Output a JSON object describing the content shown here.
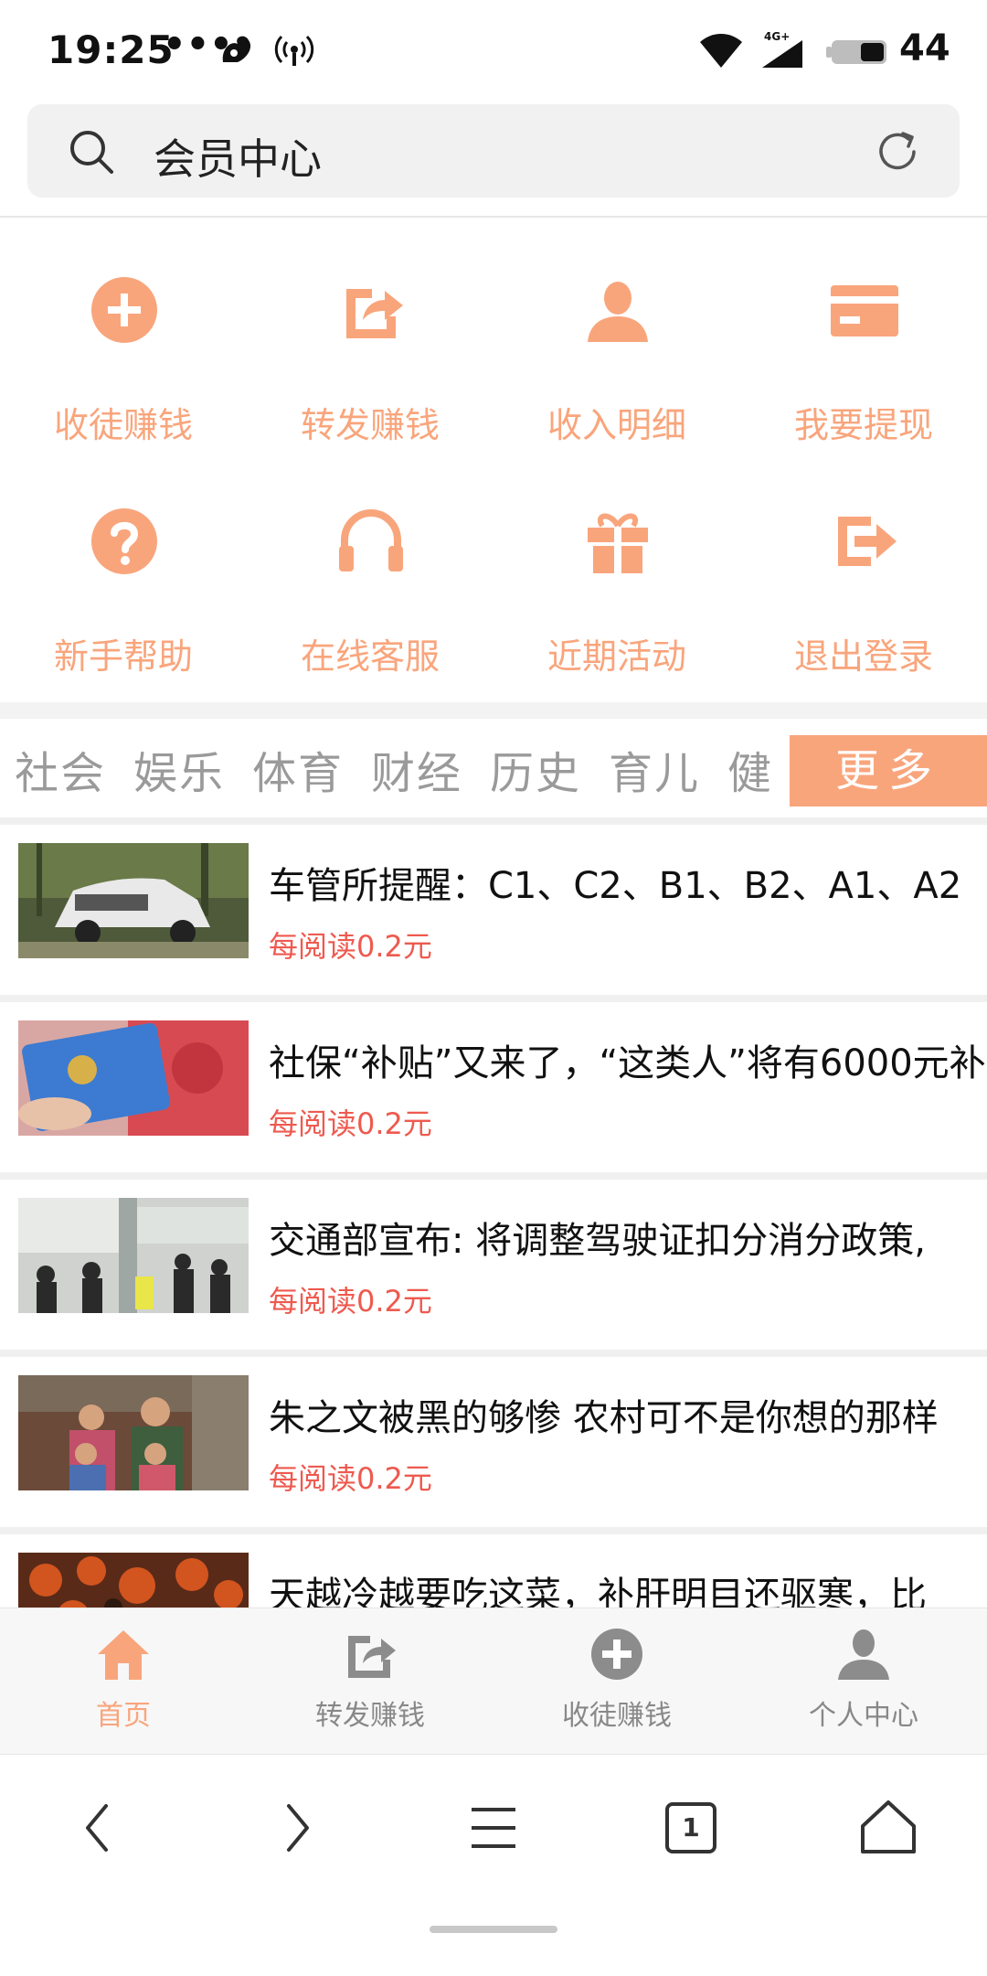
{
  "status_bar": {
    "time": "19:25",
    "dots": "•••",
    "battery": "44",
    "network": "4G+"
  },
  "search": {
    "text": "会员中心",
    "icon": "search-icon",
    "refresh_icon": "refresh-icon"
  },
  "menu": {
    "accent_color": "#f9a57c",
    "items": [
      {
        "label": "收徒赚钱",
        "icon": "plus-circle-icon"
      },
      {
        "label": "转发赚钱",
        "icon": "share-icon"
      },
      {
        "label": "收入明细",
        "icon": "user-icon"
      },
      {
        "label": "我要提现",
        "icon": "card-icon"
      },
      {
        "label": "新手帮助",
        "icon": "question-icon"
      },
      {
        "label": "在线客服",
        "icon": "headphones-icon"
      },
      {
        "label": "近期活动",
        "icon": "gift-icon"
      },
      {
        "label": "退出登录",
        "icon": "logout-icon"
      }
    ]
  },
  "categories": {
    "items": [
      "社会",
      "娱乐",
      "体育",
      "财经",
      "历史",
      "育儿",
      "健"
    ],
    "more_label": "更多"
  },
  "news": [
    {
      "title": "车管所提醒：C1、C2、B1、B2、A1、A2",
      "reward": "每阅读0.2元"
    },
    {
      "title": "社保“补贴”又来了，“这类人”将有6000元补",
      "reward": "每阅读0.2元"
    },
    {
      "title": "交通部宣布: 将调整驾驶证扣分消分政策,",
      "reward": "每阅读0.2元"
    },
    {
      "title": "朱之文被黑的够惨 农村可不是你想的那样",
      "reward": "每阅读0.2元"
    },
    {
      "title": "天越冷越要吃这菜，补肝明目还驱寒，比",
      "reward": ""
    }
  ],
  "bottom_nav": {
    "items": [
      {
        "label": "首页",
        "icon": "home-icon",
        "active": true
      },
      {
        "label": "转发赚钱",
        "icon": "share-icon"
      },
      {
        "label": "收徒赚钱",
        "icon": "plus-circle-icon"
      },
      {
        "label": "个人中心",
        "icon": "user-icon"
      }
    ]
  },
  "browser": {
    "tab_count": "1"
  }
}
